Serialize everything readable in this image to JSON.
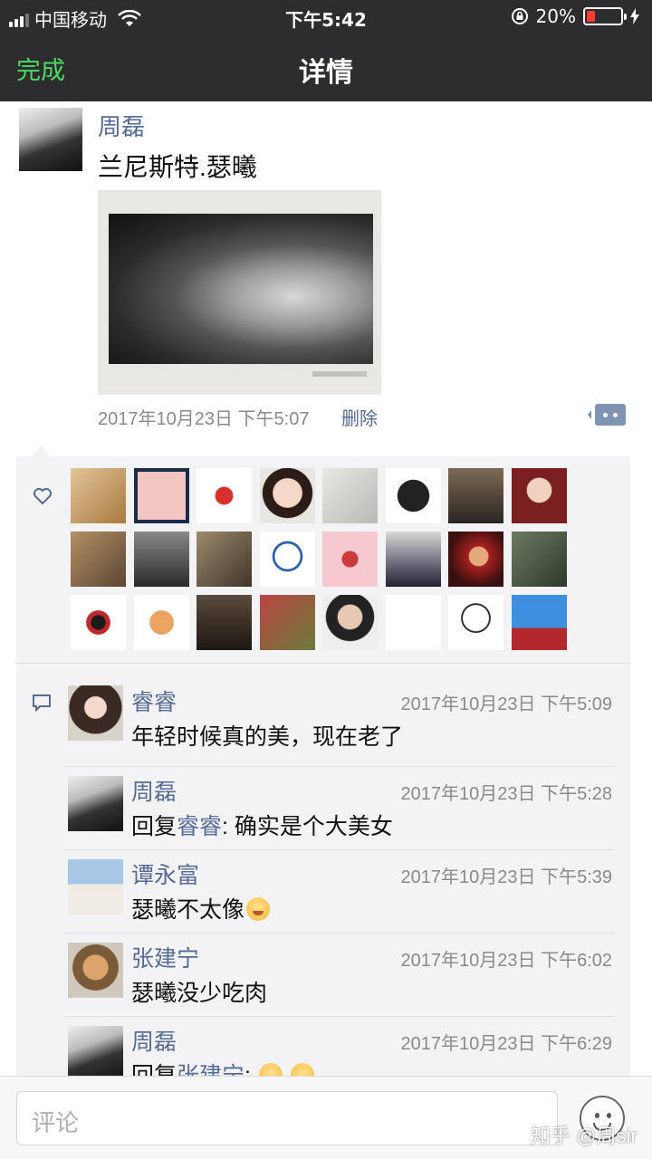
{
  "status_bar": {
    "carrier": "中国移动",
    "time": "下午5:42",
    "battery_percent": "20%",
    "battery_level": 0.2,
    "battery_color": "#ff3b30"
  },
  "nav": {
    "done_label": "完成",
    "title": "详情",
    "done_color": "#4cd964"
  },
  "post": {
    "author": "周磊",
    "text": "兰尼斯特.瑟曦",
    "timestamp": "2017年10月23日 下午5:07",
    "delete_label": "删除",
    "image_desc": "pencil-portrait-drawing"
  },
  "likes": {
    "icon": "heart-icon",
    "avatars": [
      "avatar-1",
      "avatar-2",
      "avatar-3",
      "avatar-4",
      "avatar-5",
      "avatar-6",
      "avatar-7",
      "avatar-8",
      "avatar-9",
      "avatar-10",
      "avatar-11",
      "avatar-12",
      "avatar-13",
      "avatar-14",
      "avatar-15",
      "avatar-16",
      "avatar-17",
      "avatar-18",
      "avatar-19",
      "avatar-20",
      "avatar-21",
      "avatar-22",
      "avatar-23",
      "avatar-24"
    ]
  },
  "comments": [
    {
      "name": "睿睿",
      "time": "2017年10月23日 下午5:09",
      "text": "年轻时候真的美，现在老了"
    },
    {
      "name": "周磊",
      "time": "2017年10月23日 下午5:28",
      "reply_prefix": "回复",
      "reply_to": "睿睿",
      "text": ": 确实是个大美女"
    },
    {
      "name": "谭永富",
      "time": "2017年10月23日 下午5:39",
      "text": "瑟曦不太像"
    },
    {
      "name": "张建宁",
      "time": "2017年10月23日 下午6:02",
      "text": "瑟曦没少吃肉"
    },
    {
      "name": "周磊",
      "time": "2017年10月23日 下午6:29",
      "reply_prefix": "回复",
      "reply_to": "张建宁",
      "text": ":"
    }
  ],
  "bottom": {
    "input_placeholder": "评论",
    "watermark": "知乎 @周sir"
  },
  "colors": {
    "link": "#576b95",
    "panel_bg": "#f3f3f5",
    "nav_bg": "#2d2d2f"
  }
}
